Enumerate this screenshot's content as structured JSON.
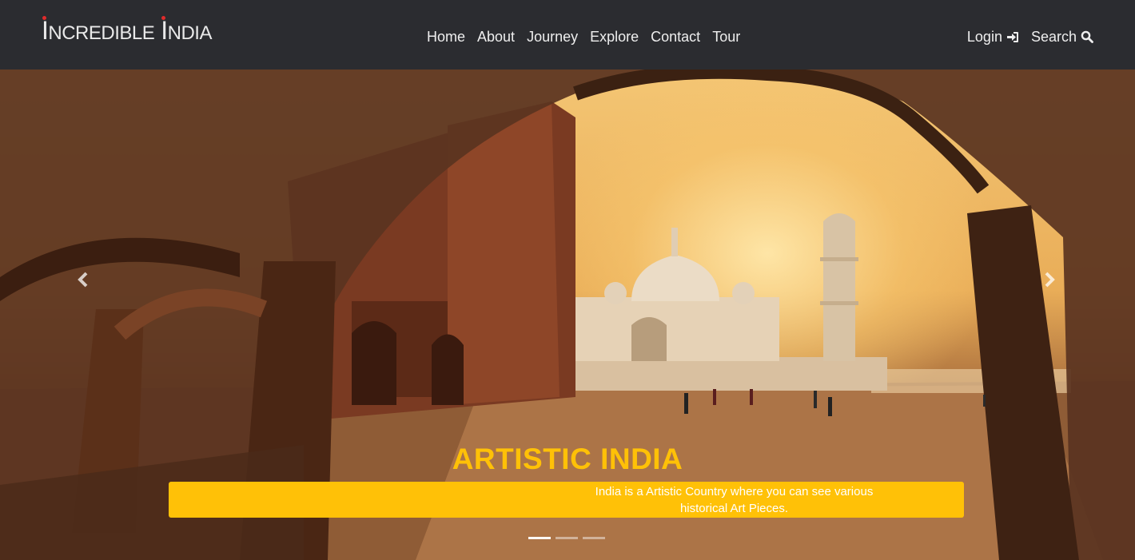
{
  "brand": {
    "part1_initial": "I",
    "part1_rest": "NCREDIBLE",
    "part2_initial": "I",
    "part2_rest": "NDIA"
  },
  "nav": {
    "links": [
      "Home",
      "About",
      "Journey",
      "Explore",
      "Contact",
      "Tour"
    ],
    "login_label": "Login",
    "search_label": "Search"
  },
  "carousel": {
    "slide_title": "ARTISTIC INDIA",
    "slide_text": "India is a Artistic Country where you can see various historical Art Pieces.",
    "indicator_count": 3,
    "active_indicator": 0
  },
  "colors": {
    "navbar_bg": "#2b2c30",
    "accent": "#ffc107",
    "brand_dot": "#e12b2b"
  },
  "icons": {
    "login": "sign-in-icon",
    "search": "search-icon",
    "prev": "chevron-left-icon",
    "next": "chevron-right-icon"
  }
}
